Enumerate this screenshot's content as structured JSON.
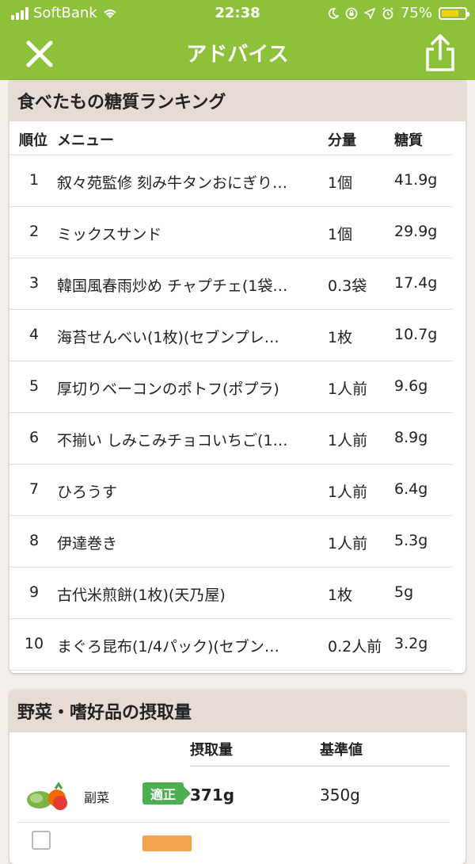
{
  "status_bar": {
    "carrier": "SoftBank",
    "time": "22:38",
    "battery": "75%",
    "battery_level": 0.75,
    "icons": [
      "signal-icon",
      "wifi-icon",
      "moon-icon",
      "rotation-lock-icon",
      "location-icon",
      "alarm-icon",
      "battery-icon"
    ]
  },
  "nav": {
    "title": "アドバイス",
    "close_icon": "close-icon",
    "share_icon": "share-icon"
  },
  "ranking": {
    "title": "食べたもの糖質ランキング",
    "headers": {
      "rank": "順位",
      "menu": "メニュー",
      "amount": "分量",
      "carb": "糖質"
    },
    "rows": [
      {
        "rank": "1",
        "menu": "叙々苑監修 刻み牛タンおにぎり…",
        "amount": "1個",
        "carb": "41.9g"
      },
      {
        "rank": "2",
        "menu": "ミックスサンド",
        "amount": "1個",
        "carb": "29.9g"
      },
      {
        "rank": "3",
        "menu": "韓国風春雨炒め チャプチェ(1袋…",
        "amount": "0.3袋",
        "carb": "17.4g"
      },
      {
        "rank": "4",
        "menu": "海苔せんべい(1枚)(セブンプレ…",
        "amount": "1枚",
        "carb": "10.7g"
      },
      {
        "rank": "5",
        "menu": "厚切りベーコンのポトフ(ポプラ)",
        "amount": "1人前",
        "carb": "9.6g"
      },
      {
        "rank": "6",
        "menu": "不揃い しみこみチョコいちご(1…",
        "amount": "1人前",
        "carb": "8.9g"
      },
      {
        "rank": "7",
        "menu": "ひろうす",
        "amount": "1人前",
        "carb": "6.4g"
      },
      {
        "rank": "8",
        "menu": "伊達巻き",
        "amount": "1人前",
        "carb": "5.3g"
      },
      {
        "rank": "9",
        "menu": "古代米煎餅(1枚)(天乃屋)",
        "amount": "1枚",
        "carb": "5g"
      },
      {
        "rank": "10",
        "menu": "まぐろ昆布(1/4パック)(セブン…",
        "amount": "0.2人前",
        "carb": "3.2g"
      }
    ]
  },
  "intake": {
    "title": "野菜・嗜好品の摂取量",
    "headers": {
      "amount": "摂取量",
      "standard": "基準値"
    },
    "rows": [
      {
        "label": "副菜",
        "badge": "適正",
        "amount": "371g",
        "standard": "350g",
        "icon": "vegetables-icon"
      }
    ]
  },
  "colors": {
    "header_green": "#8dc13a",
    "badge_green": "#4caf50",
    "section_bg": "#e6dcd5",
    "orange": "#f5a34a"
  }
}
